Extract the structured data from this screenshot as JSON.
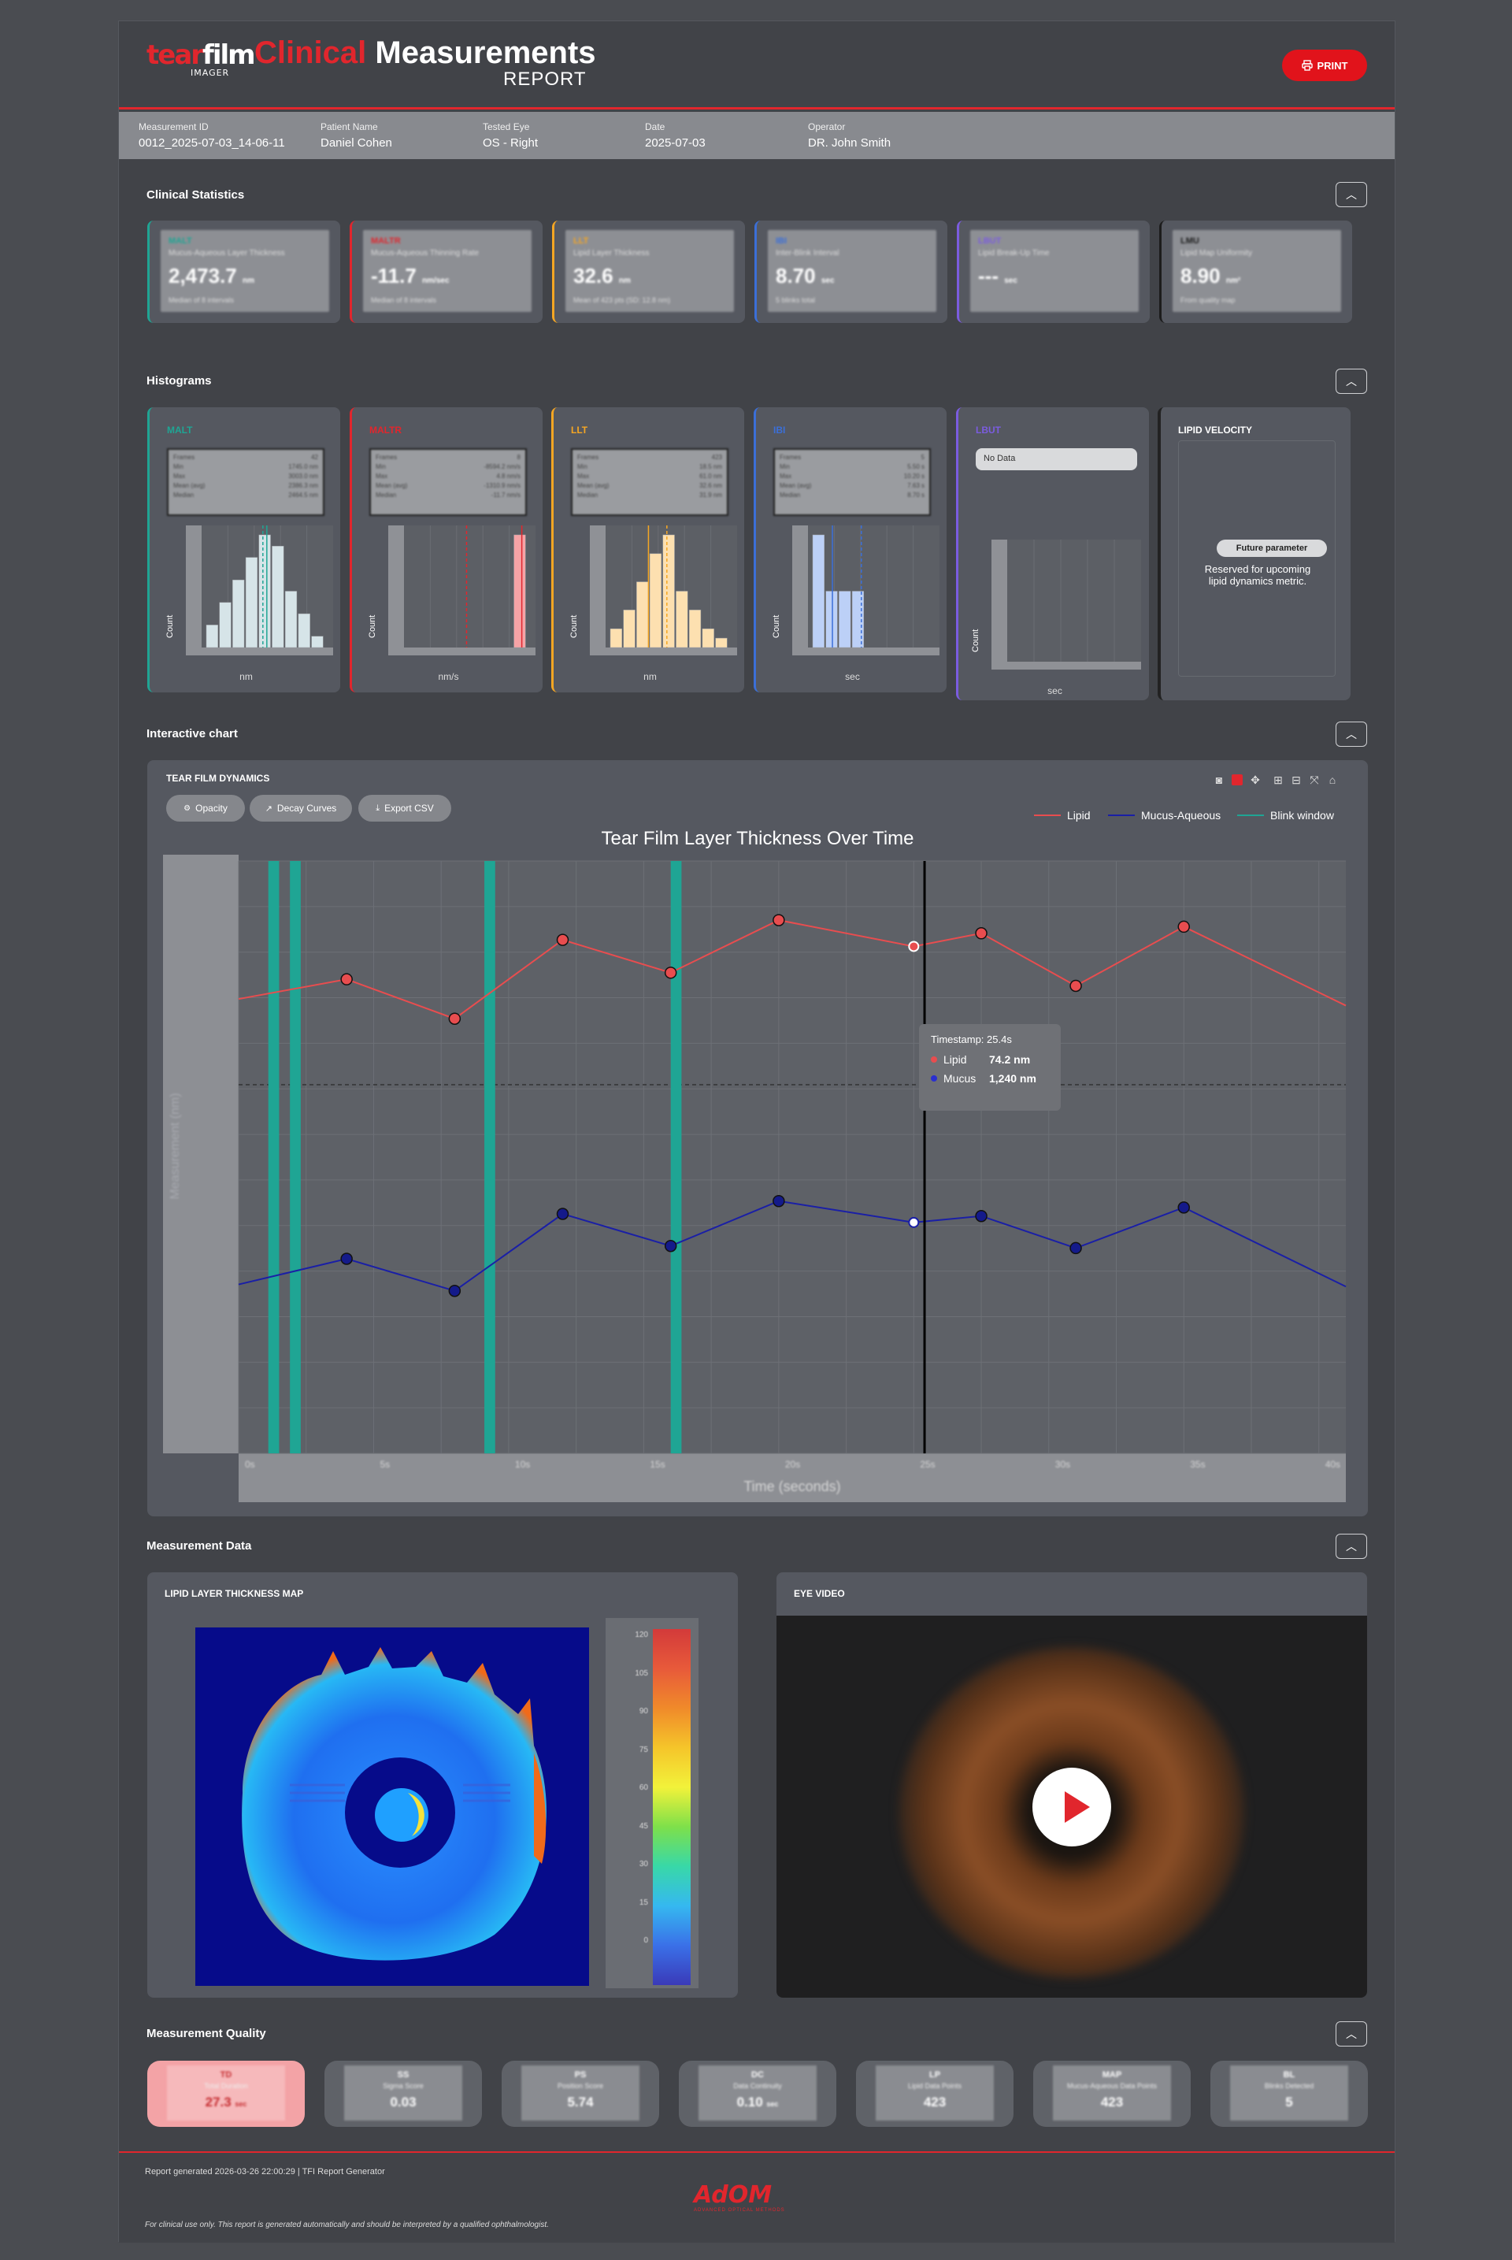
{
  "header": {
    "logo_part1": "tear",
    "logo_part2": "film",
    "logo_sub": "IMAGER",
    "title_red": "Clinical",
    "title_white": "Measurements",
    "title_sub": "REPORT",
    "print_label": "PRINT"
  },
  "info": [
    {
      "label": "Measurement ID",
      "value": "0012_2025-07-03_14-06-11"
    },
    {
      "label": "Patient Name",
      "value": "Daniel Cohen"
    },
    {
      "label": "Tested Eye",
      "value": "OS - Right"
    },
    {
      "label": "Date",
      "value": "2025-07-03"
    },
    {
      "label": "Operator",
      "value": "DR. John Smith"
    }
  ],
  "sections": {
    "stats": "Clinical Statistics",
    "hist": "Histograms",
    "chart": "Interactive chart",
    "mdata": "Measurement Data",
    "quality": "Measurement Quality",
    "collapse_icon": "chevron-up-icon"
  },
  "stats": [
    {
      "abbr": "MALT",
      "name": "Mucus-Aqueous Layer Thickness",
      "value": "2,473.7",
      "unit": "nm",
      "note": "Median of 8 intervals",
      "color": "#1fa594"
    },
    {
      "abbr": "MALTR",
      "name": "Mucus-Aqueous Thinning Rate",
      "value": "-11.7",
      "unit": "nm/sec",
      "note": "Median of 8 intervals",
      "color": "#e1262d"
    },
    {
      "abbr": "LLT",
      "name": "Lipid Layer Thickness",
      "value": "32.6",
      "unit": "nm",
      "note": "Mean of 423 pts (SD: 12.8 nm)",
      "color": "#f5a623"
    },
    {
      "abbr": "IBI",
      "name": "Inter-Blink Interval",
      "value": "8.70",
      "unit": "sec",
      "note": "5 blinks total",
      "color": "#3b6fd8"
    },
    {
      "abbr": "LBUT",
      "name": "Lipid Break-Up Time",
      "value": "---",
      "unit": "sec",
      "note": "",
      "color": "#7b5ce0"
    },
    {
      "abbr": "LMU",
      "name": "Lipid Map Uniformity",
      "value": "8.90",
      "unit": "nm²",
      "note": "From quality map",
      "color": "#1c1c1c"
    }
  ],
  "hist": [
    {
      "label": "MALT",
      "color": "#1fa594",
      "unit": "nm",
      "stats": [
        [
          "Frames",
          "42"
        ],
        [
          "Min",
          "1745.0 nm"
        ],
        [
          "Max",
          "3003.0 nm"
        ],
        [
          "Mean (avg)",
          "2386.3 nm"
        ],
        [
          "Median",
          "2464.5 nm"
        ]
      ],
      "bars": [
        2,
        4,
        6,
        8,
        10,
        9,
        5,
        3,
        1
      ],
      "bar_color": "#d6e4e8",
      "median": 4.6,
      "mean": 4.3,
      "legend_median": "Median",
      "legend_mean": "Mean",
      "ylabel": "Count"
    },
    {
      "label": "MALTR",
      "color": "#e1262d",
      "unit": "nm/s",
      "stats": [
        [
          "Frames",
          "8"
        ],
        [
          "Min",
          "-8594.2 nm/s"
        ],
        [
          "Max",
          "4.8 nm/s"
        ],
        [
          "Mean (avg)",
          "-1310.9 nm/s"
        ],
        [
          "Median",
          "-11.7 nm/s"
        ]
      ],
      "bars": [
        0,
        0,
        0,
        0,
        0,
        0,
        0,
        0,
        10
      ],
      "bar_color": "#f6a3a6",
      "median": 8.6,
      "mean": 4.4,
      "legend_median": "Median",
      "legend_mean": "Mean",
      "ylabel": "Count"
    },
    {
      "label": "LLT",
      "color": "#f5a623",
      "unit": "nm",
      "stats": [
        [
          "Frames",
          "423"
        ],
        [
          "Min",
          "18.5 nm"
        ],
        [
          "Max",
          "61.0 nm"
        ],
        [
          "Mean (avg)",
          "32.6 nm"
        ],
        [
          "Median",
          "31.9 nm"
        ]
      ],
      "bars": [
        2,
        4,
        7,
        10,
        12,
        6,
        4,
        2,
        1
      ],
      "bar_color": "#fde0b0",
      "median": 2.9,
      "mean": 4.3,
      "legend_median": "Median",
      "legend_mean": "Mean",
      "ylabel": "Count"
    },
    {
      "label": "IBI",
      "color": "#3b6fd8",
      "unit": "sec",
      "stats": [
        [
          "Frames",
          "5"
        ],
        [
          "Min",
          "5.50 s"
        ],
        [
          "Max",
          "10.20 s"
        ],
        [
          "Mean (avg)",
          "7.63 s"
        ],
        [
          "Median",
          "8.70 s"
        ]
      ],
      "bars": [
        10,
        5,
        5,
        5,
        0,
        0,
        0,
        0,
        0
      ],
      "bar_color": "#bcd0f7",
      "median": 1.5,
      "mean": 3.7,
      "legend_median": "Median",
      "legend_mean": "Mean",
      "ylabel": "Count"
    },
    {
      "label": "LBUT",
      "color": "#7b5ce0",
      "unit": "sec",
      "nodata": "No Data",
      "legend_median": "Median",
      "legend_mean": "Mean",
      "ylabel": "Count"
    }
  ],
  "lipid_velocity": {
    "title": "LIPID VELOCITY",
    "badge": "Future parameter",
    "desc": "Reserved for upcoming lipid dynamics metric."
  },
  "chart": {
    "card_title": "TEAR FILM DYNAMICS",
    "buttons": [
      "Opacity",
      "Decay Curves",
      "Export CSV"
    ],
    "legend": [
      {
        "name": "Lipid",
        "color": "#e84d4f"
      },
      {
        "name": "Mucus-Aqueous",
        "color": "#1a1fa6"
      },
      {
        "name": "Blink window",
        "color": "#1fa594"
      }
    ],
    "tooltip": {
      "timestamp": "Timestamp: 25.4s",
      "lipid_label": "Lipid",
      "lipid_value": "74.2 nm",
      "mucus_label": "Mucus",
      "mucus_value": "1,240 nm"
    },
    "tool_icons": [
      "camera-icon",
      "zoom-icon",
      "pan-icon",
      "zoom-in-icon",
      "zoom-out-icon",
      "autoscale-icon",
      "home-icon"
    ]
  },
  "chart_data": {
    "type": "line",
    "title": "Tear Film Layer Thickness Over Time",
    "xlabel": "Time (seconds)",
    "ylabel": "Measurement (nm)",
    "x_ticks": [
      "0s",
      "5s",
      "10s",
      "15s",
      "20s",
      "25s",
      "30s",
      "35s",
      "40s"
    ],
    "xlim": [
      0,
      41
    ],
    "series": [
      {
        "name": "Lipid",
        "x": [
          0,
          4,
          8,
          12,
          16,
          20,
          25,
          27.5,
          31,
          35,
          41
        ],
        "y": [
          69,
          72,
          66,
          78,
          73,
          81,
          77,
          79,
          71,
          80,
          68
        ]
      },
      {
        "name": "Mucus-Aqueous",
        "x": [
          0,
          4,
          8,
          12,
          16,
          20,
          25,
          27.5,
          31,
          35,
          41
        ],
        "y": [
          1095,
          1155,
          1080,
          1260,
          1185,
          1290,
          1240,
          1255,
          1180,
          1275,
          1090
        ]
      }
    ],
    "blink_windows": [
      [
        1.1,
        1.5
      ],
      [
        1.9,
        2.3
      ],
      [
        9.1,
        9.5
      ],
      [
        16.0,
        16.4
      ]
    ],
    "cursor_x": 25.4
  },
  "mdata": {
    "map_title": "LIPID LAYER THICKNESS MAP",
    "video_title": "EYE VIDEO",
    "colorbar_ticks": [
      "120",
      "105",
      "90",
      "75",
      "60",
      "45",
      "30",
      "15",
      "0"
    ],
    "play_icon": "play-icon"
  },
  "quality": [
    {
      "abbr": "TD",
      "name": "Total Duration",
      "value": "27.3",
      "unit": "sec",
      "alert": true
    },
    {
      "abbr": "SS",
      "name": "Sigma Score",
      "value": "0.03",
      "unit": "",
      "alert": false
    },
    {
      "abbr": "PS",
      "name": "Position Score",
      "value": "5.74",
      "unit": "",
      "alert": false
    },
    {
      "abbr": "DC",
      "name": "Data Continuity",
      "value": "0.10",
      "unit": "sec",
      "alert": false
    },
    {
      "abbr": "LP",
      "name": "Lipid Data Points",
      "value": "423",
      "unit": "",
      "alert": false
    },
    {
      "abbr": "MAP",
      "name": "Mucus-Aqueous Data Points",
      "value": "423",
      "unit": "",
      "alert": false
    },
    {
      "abbr": "BL",
      "name": "Blinks Detected",
      "value": "5",
      "unit": "",
      "alert": false
    }
  ],
  "footer": {
    "generated": "Report generated 2026-03-26 22:00:29 | TFI Report Generator",
    "brand": "AdOM",
    "brand_sub": "ADVANCED OPTICAL METHODS",
    "disclaimer": "For clinical use only. This report is generated automatically and should be interpreted by a qualified ophthalmologist."
  }
}
